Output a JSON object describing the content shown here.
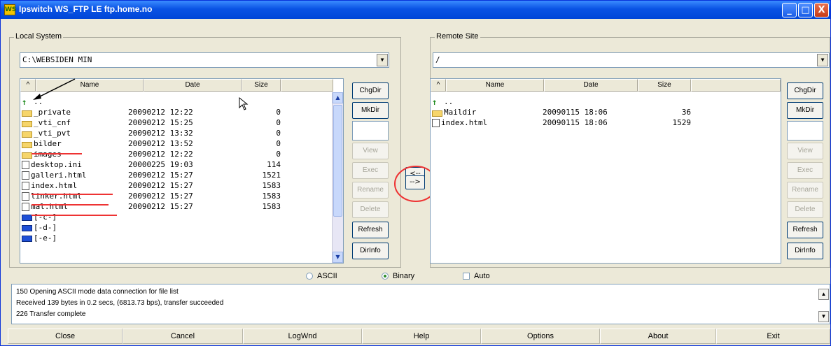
{
  "window": {
    "title": "Ipswitch WS_FTP LE ftp.home.no",
    "controls": [
      "_",
      "□",
      "X"
    ]
  },
  "local": {
    "group_label": "Local System",
    "path": "C:\\WEBSIDEN MIN",
    "columns": [
      "^",
      "Name",
      "Date",
      "Size"
    ],
    "rows": [
      {
        "icon": "up-arrow-icon",
        "name": "..",
        "date": "",
        "size": ""
      },
      {
        "icon": "folder-icon",
        "name": "_private",
        "date": "20090212 12:22",
        "size": "0"
      },
      {
        "icon": "folder-icon",
        "name": "_vti_cnf",
        "date": "20090212 15:25",
        "size": "0"
      },
      {
        "icon": "folder-icon",
        "name": "_vti_pvt",
        "date": "20090212 13:32",
        "size": "0"
      },
      {
        "icon": "folder-icon",
        "name": "bilder",
        "date": "20090212 13:52",
        "size": "0"
      },
      {
        "icon": "folder-icon",
        "name": "images",
        "date": "20090212 12:22",
        "size": "0"
      },
      {
        "icon": "file-icon",
        "name": "desktop.ini",
        "date": "20000225 19:03",
        "size": "114"
      },
      {
        "icon": "file-icon",
        "name": "galleri.html",
        "date": "20090212 15:27",
        "size": "1521"
      },
      {
        "icon": "file-icon",
        "name": "index.html",
        "date": "20090212 15:27",
        "size": "1583"
      },
      {
        "icon": "file-icon",
        "name": "linker.html",
        "date": "20090212 15:27",
        "size": "1583"
      },
      {
        "icon": "file-icon",
        "name": "mal.html",
        "date": "20090212 15:27",
        "size": "1583"
      },
      {
        "icon": "drive-icon",
        "name": "[-c-]",
        "date": "",
        "size": ""
      },
      {
        "icon": "drive-icon",
        "name": "[-d-]",
        "date": "",
        "size": ""
      },
      {
        "icon": "drive-icon",
        "name": "[-e-]",
        "date": "",
        "size": ""
      }
    ],
    "buttons": [
      "ChgDir",
      "MkDir",
      "View",
      "Exec",
      "Rename",
      "Delete",
      "Refresh",
      "DirInfo"
    ]
  },
  "remote": {
    "group_label": "Remote Site",
    "path": "/",
    "columns": [
      "^",
      "Name",
      "Date",
      "Size"
    ],
    "rows": [
      {
        "icon": "up-arrow-icon",
        "name": "..",
        "date": "",
        "size": ""
      },
      {
        "icon": "folder-icon",
        "name": "Maildir",
        "date": "20090115 18:06",
        "size": "36"
      },
      {
        "icon": "file-icon",
        "name": "index.html",
        "date": "20090115 18:06",
        "size": "1529"
      }
    ],
    "buttons": [
      "ChgDir",
      "MkDir",
      "View",
      "Exec",
      "Rename",
      "Delete",
      "Refresh",
      "DirInfo"
    ]
  },
  "transfer": {
    "to_local": "<--",
    "to_remote": "-->"
  },
  "mode": {
    "ascii": "ASCII",
    "binary": "Binary",
    "auto": "Auto",
    "selected": "Binary"
  },
  "log": [
    "150 Opening ASCII mode data connection for file list",
    "Received 139 bytes in 0.2 secs, (6813.73 bps), transfer succeeded",
    "226 Transfer complete"
  ],
  "bottom_buttons": [
    "Close",
    "Cancel",
    "LogWnd",
    "Help",
    "Options",
    "About",
    "Exit"
  ],
  "colors": {
    "titlebar": "#0a53e4",
    "window_bg": "#ece9d8",
    "annotation": "#e33333"
  }
}
